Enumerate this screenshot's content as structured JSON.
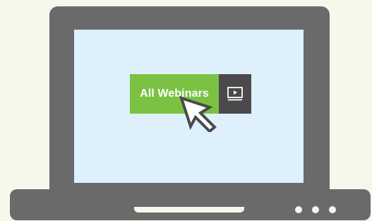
{
  "webinar_button": {
    "label": "All Webinars",
    "icon": "video-play-icon",
    "label_color": "#7cc242",
    "icon_box_color": "#4a4a4c"
  },
  "cursor": {
    "icon": "arrow-cursor-icon"
  },
  "colors": {
    "background": "#f6f8ec",
    "laptop_body": "#6a6a6a",
    "screen": "#dff0fd"
  },
  "indicator_lights": [
    "led-1",
    "led-2",
    "led-3"
  ]
}
